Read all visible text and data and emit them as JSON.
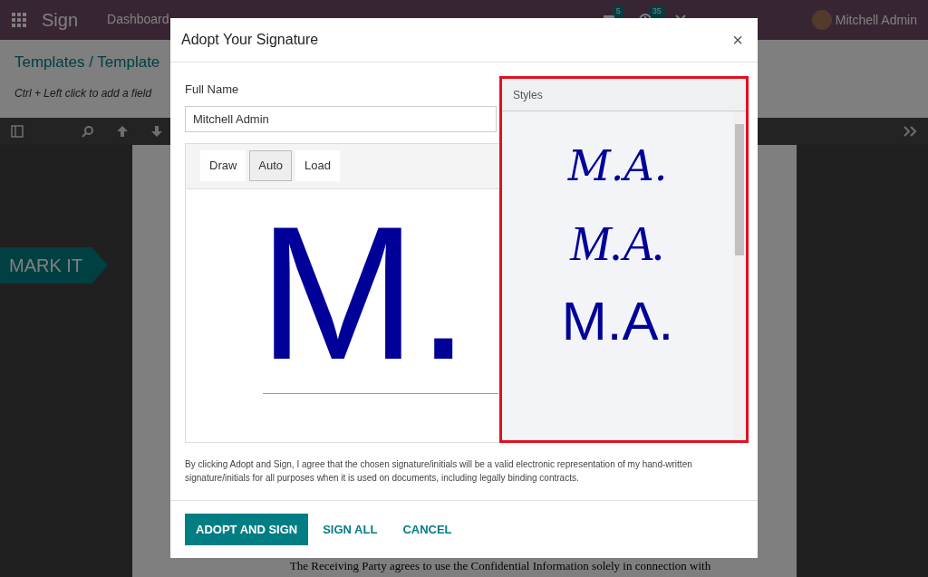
{
  "navbar": {
    "app_name": "Sign",
    "menu": [
      "Dashboard"
    ],
    "messages_count": "5",
    "activities_count": "35",
    "user": "Mitchell Admin"
  },
  "page": {
    "breadcrumb": "Templates / Template",
    "hint": "Ctrl + Left click to add a field",
    "mark_label": "MARK IT",
    "document_text": "The Receiving Party agrees to use the Confidential Information solely in connection with"
  },
  "dialog": {
    "title": "Adopt Your Signature",
    "close": "×",
    "full_name_label": "Full Name",
    "full_name_value": "Mitchell Admin",
    "tabs": [
      {
        "label": "Draw",
        "selected": false
      },
      {
        "label": "Auto",
        "selected": true
      },
      {
        "label": "Load",
        "selected": false
      }
    ],
    "preview": "M.",
    "styles_title": "Styles",
    "styles": [
      {
        "text": "M.A.",
        "kind": "script"
      },
      {
        "text": "M.A.",
        "kind": "cursive"
      },
      {
        "text": "M.A.",
        "kind": "print"
      }
    ],
    "disclaimer": "By clicking Adopt and Sign, I agree that the chosen signature/initials will be a valid electronic representation of my hand-written signature/initials for all purposes when it is used on documents, including legally binding contracts.",
    "buttons": [
      {
        "label": "ADOPT AND SIGN",
        "kind": "primary"
      },
      {
        "label": "SIGN ALL",
        "kind": "link"
      },
      {
        "label": "CANCEL",
        "kind": "link"
      }
    ]
  }
}
